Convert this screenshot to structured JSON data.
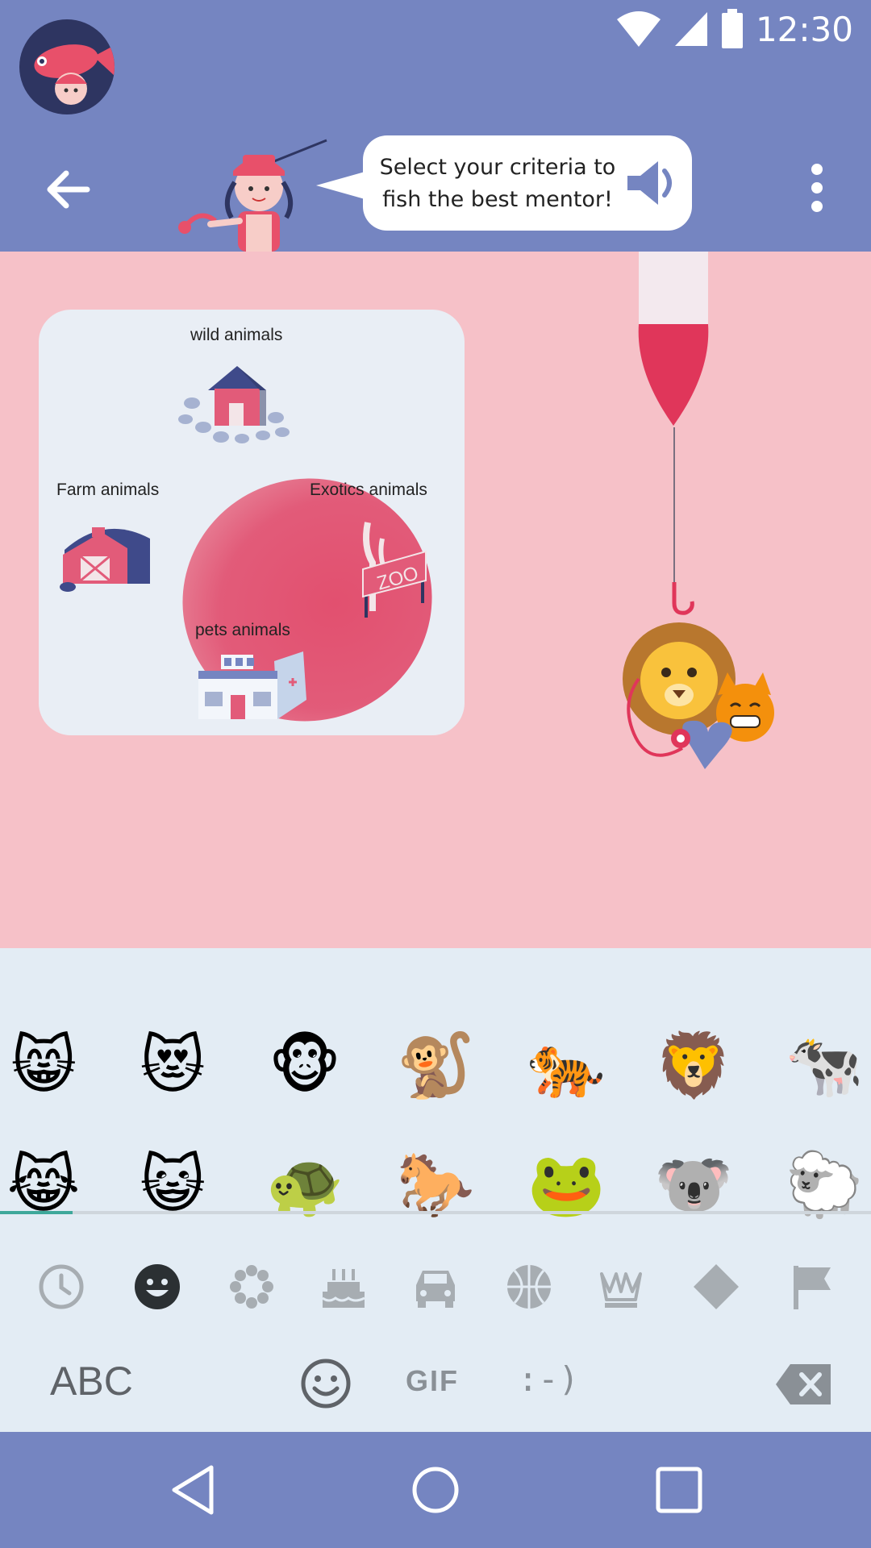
{
  "status_bar": {
    "time": "12:30",
    "icons": [
      "wifi-icon",
      "signal-icon",
      "battery-icon"
    ]
  },
  "app_bar": {
    "back_icon": "arrow-left-icon",
    "speech_bubble_text": "Select your criteria to fish the best mentor!",
    "speaker_icon": "speaker-icon",
    "menu_icon": "more-vert-icon"
  },
  "criteria": {
    "labels": [
      "wild animals",
      "Farm animals",
      "Exotics animals",
      "pets animals"
    ],
    "zoo_sign": "ZOO"
  },
  "emoji_keyboard": {
    "row1": [
      "😸",
      "😻",
      "🐵",
      "🐒",
      "🐅",
      "🦁",
      "🐄"
    ],
    "row2": [
      "😹",
      "😺",
      "🐢",
      "🐎",
      "🐸",
      "🐨",
      "🐑"
    ],
    "categories": [
      "recent-icon",
      "smileys-icon",
      "nature-icon",
      "food-icon",
      "travel-icon",
      "activity-icon",
      "objects-icon",
      "symbols-icon",
      "flags-icon"
    ],
    "abc_key": "ABC",
    "gif_key": "GIF",
    "emoticon_key": ":-)"
  },
  "colors": {
    "brand": "#7585c1",
    "background": "#f6c1c8",
    "accent": "#e2506f",
    "keyboard_bg": "#e3ecf4",
    "scroll_indicator": "#3ea89a"
  }
}
